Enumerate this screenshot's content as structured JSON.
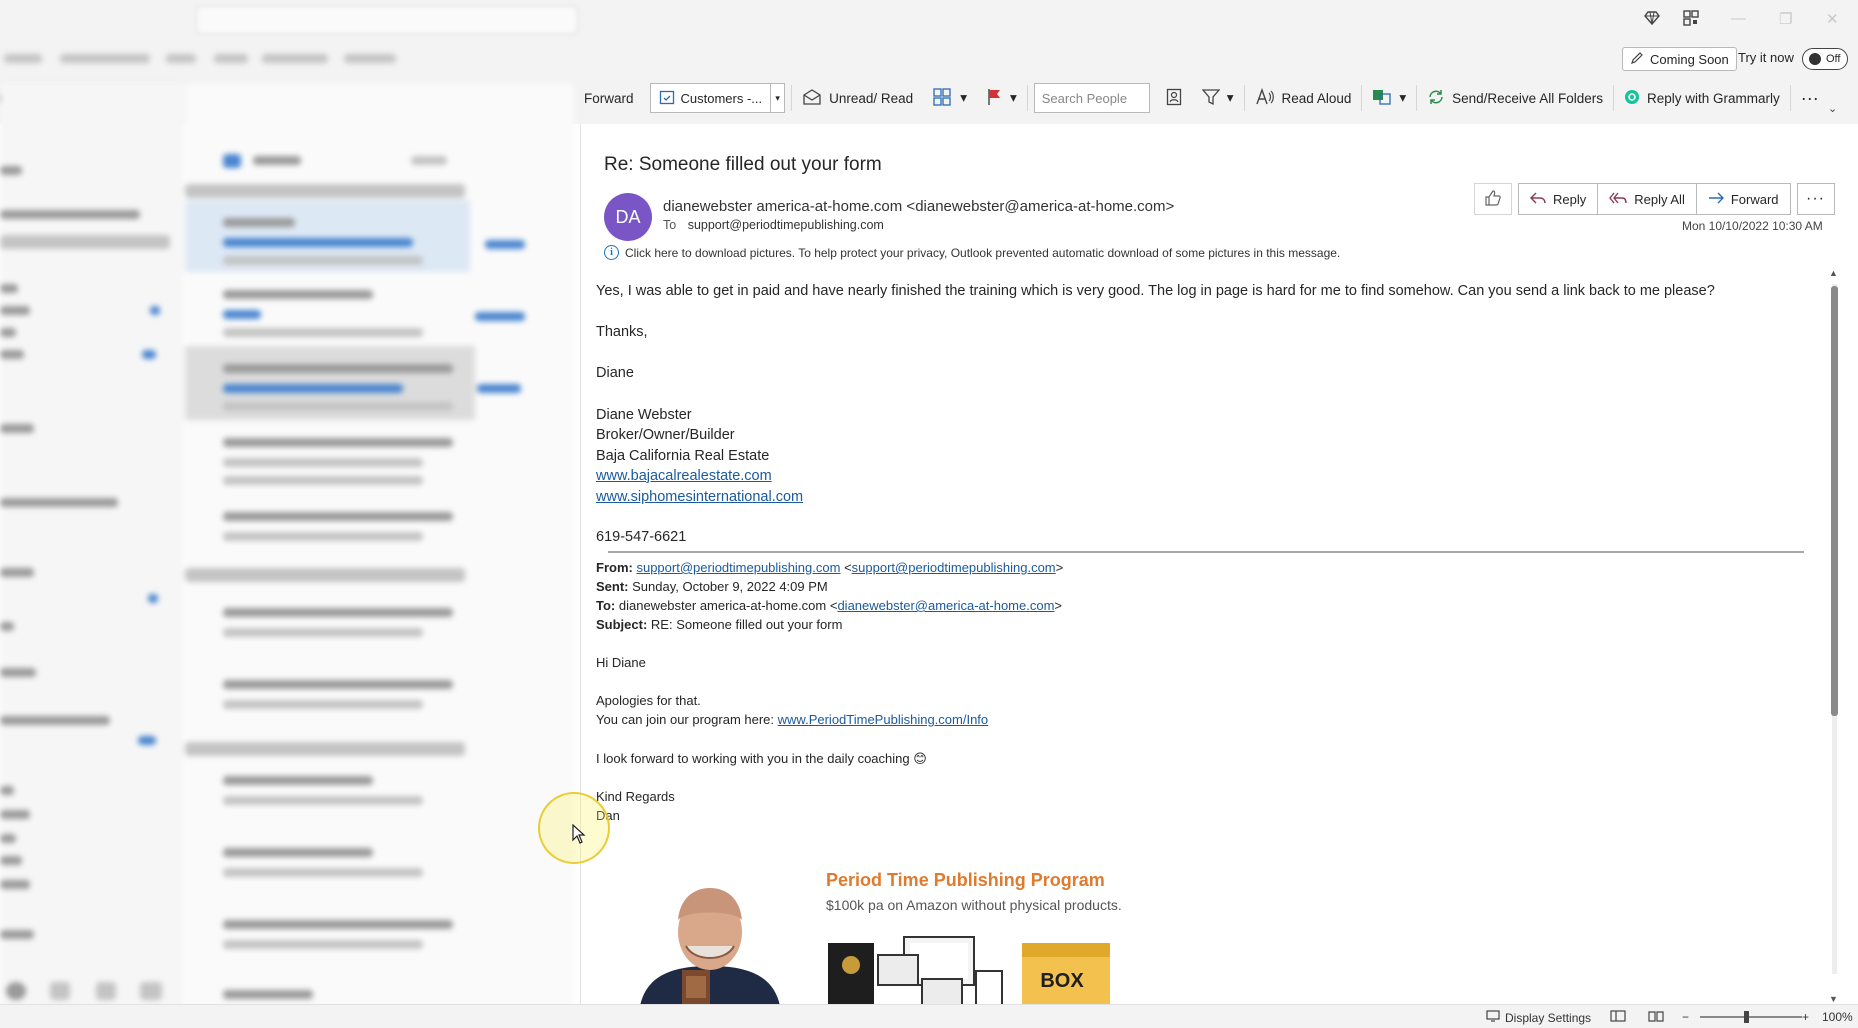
{
  "window": {
    "minimize_glyph": "—",
    "restore_glyph": "❐",
    "close_glyph": "✕"
  },
  "top_right": {
    "coming_soon": "Coming Soon",
    "try_now": "Try it now",
    "toggle_state": "Off"
  },
  "ribbon": {
    "forward": "Forward",
    "quick_step": "Customers -...",
    "unread_read": "Unread/ Read",
    "search_people_placeholder": "Search People",
    "read_aloud": "Read Aloud",
    "send_receive": "Send/Receive All Folders",
    "grammarly": "Reply with Grammarly",
    "more": "···"
  },
  "message": {
    "subject": "Re: Someone filled out your form",
    "avatar_initials": "DA",
    "avatar_color": "#7a55c6",
    "from": "dianewebster america-at-home.com <dianewebster@america-at-home.com>",
    "to_label": "To",
    "to": "support@periodtimepublishing.com",
    "datetime": "Mon 10/10/2022 10:30 AM",
    "info_bar": "Click here to download pictures. To help protect your privacy, Outlook prevented automatic download of some pictures in this message.",
    "actions": {
      "reply": "Reply",
      "reply_all": "Reply All",
      "forward": "Forward",
      "more": "···"
    },
    "body": {
      "line1": "Yes, I was able to get in paid and have nearly finished the training which is very good. The log in page is hard for me to find somehow. Can you send a link back to me please?",
      "thanks": "Thanks,",
      "name": "Diane",
      "sig_name": "Diane Webster",
      "sig_title": "Broker/Owner/Builder",
      "sig_company": "Baja California Real Estate",
      "sig_link1": "www.bajacalrealestate.com",
      "sig_link2": "www.siphomesinternational.com",
      "sig_phone": "619-547-6621"
    },
    "quoted": {
      "from_label": "From:",
      "from_link1": "support@periodtimepublishing.com",
      "from_link2": "support@periodtimepublishing.com",
      "sent_label": "Sent:",
      "sent": "Sunday, October 9, 2022 4:09 PM",
      "to_label": "To:",
      "to_name": "dianewebster america-at-home.com <",
      "to_link": "dianewebster@america-at-home.com",
      "subject_label": "Subject:",
      "subject": "RE: Someone filled out your form",
      "greeting": "Hi Diane",
      "apology": "Apologies for that.",
      "join_prefix": "You can join our program here: ",
      "join_link": "www.PeriodTimePublishing.com/Info",
      "forward_line": "I look forward to working with you in the daily coaching 😊",
      "regards": "Kind Regards",
      "sender": "Dan"
    },
    "promo": {
      "title": "Period Time Publishing Program",
      "subtitle": "$100k pa on Amazon without physical products.",
      "title_color": "#e07a2e",
      "product_box_label": "BOX"
    }
  },
  "status": {
    "display_settings": "Display Settings",
    "zoom": "100%",
    "zoom_out": "−",
    "zoom_in": "+"
  }
}
